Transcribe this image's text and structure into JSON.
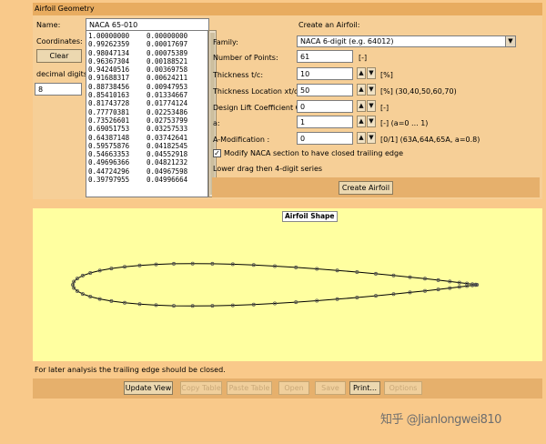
{
  "window": {
    "frame_title": "Airfoil Geometry"
  },
  "left": {
    "name_label": "Name:",
    "name_value": "NACA 65-010",
    "coordinates_label": "Coordinates:",
    "clear_label": "Clear",
    "decimal_label": "decimal digits:",
    "decimal_value": "8",
    "coordinates": [
      [
        "1.00000000",
        "0.00000000"
      ],
      [
        "0.99262359",
        "0.00017697"
      ],
      [
        "0.98047134",
        "0.00075389"
      ],
      [
        "0.96367304",
        "0.00188521"
      ],
      [
        "0.94240516",
        "0.00369758"
      ],
      [
        "0.91688317",
        "0.00624211"
      ],
      [
        "0.88738456",
        "0.00947953"
      ],
      [
        "0.85410163",
        "0.01334667"
      ],
      [
        "0.81743728",
        "0.01774124"
      ],
      [
        "0.77770381",
        "0.02253486"
      ],
      [
        "0.73526601",
        "0.02753799"
      ],
      [
        "0.69051753",
        "0.03257533"
      ],
      [
        "0.64387148",
        "0.03742641"
      ],
      [
        "0.59575876",
        "0.04182545"
      ],
      [
        "0.54663353",
        "0.04552918"
      ],
      [
        "0.49696366",
        "0.04821232"
      ],
      [
        "0.44724296",
        "0.04967598"
      ],
      [
        "0.39797955",
        "0.04996664"
      ]
    ]
  },
  "right": {
    "create_heading": "Create an Airfoil:",
    "family_label": "Family:",
    "family_value": "NACA 6-digit (e.g. 64012)",
    "points_label": "Number of Points:",
    "points_value": "61",
    "points_unit": "[-]",
    "thickness_label": "Thickness  t/c:",
    "thickness_value": "10",
    "thickness_unit": "[%]",
    "thickloc_label": "Thickness Location  xt/c:",
    "thickloc_value": "50",
    "thickloc_unit": "[%]  (30,40,50,60,70)",
    "cl_label": "Design Lift Coefficient  Cl:",
    "cl_value": "0",
    "cl_unit": "[-]",
    "a_label": "a:",
    "a_value": "1",
    "a_unit": "[-]  (a=0 ... 1)",
    "amod_label": "A-Modification  :",
    "amod_value": "0",
    "amod_unit": "[0/1]  (63A,64A,65A, a=0.8)",
    "modify_label": "Modify NACA section to have closed trailing edge",
    "modify_checked": "✓",
    "note": "Lower drag then 4-digit series",
    "create_button": "Create Airfoil",
    "up_arrow": "▲",
    "down_arrow": "▼",
    "select_caret": "▼"
  },
  "plot": {
    "title": "Airfoil Shape",
    "thickness_fraction": 0.1,
    "points": 61,
    "closed_trailing_edge": true,
    "line_color": "#000000",
    "marker_color": "#555555"
  },
  "footer": {
    "note": "For later analysis the trailing edge should be closed.",
    "buttons": [
      "Update View",
      "Copy Table",
      "Paste Table",
      "Open",
      "Save",
      "Print...",
      "Options"
    ],
    "enabled": [
      true,
      false,
      false,
      false,
      false,
      true,
      false
    ]
  },
  "watermark": "知乎 @Jianlongwei810"
}
